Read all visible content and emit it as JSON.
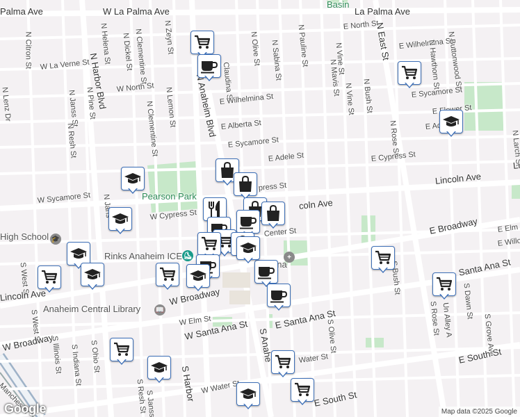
{
  "map": {
    "attribution": "Map data ©2025 Google",
    "logo": "Google"
  },
  "streets": [
    {
      "id": "w-la-palma-ave",
      "text": "W La Palma Ave",
      "cls": "major"
    },
    {
      "id": "la-palma-ave-east",
      "text": "La Palma Ave",
      "cls": "major"
    },
    {
      "id": "la-palma-ave-west",
      "text": "Palma Ave",
      "cls": "major"
    },
    {
      "id": "n-citron-st",
      "text": "N Citron St"
    },
    {
      "id": "n-helena-st",
      "text": "N Helena St"
    },
    {
      "id": "n-dickel-st",
      "text": "N Dickel St"
    },
    {
      "id": "n-clementine-st-top",
      "text": "N Clementine St"
    },
    {
      "id": "n-zeyn-st",
      "text": "N Zeyn St"
    },
    {
      "id": "n-olive-st",
      "text": "N Olive St"
    },
    {
      "id": "n-sabina-st",
      "text": "N Sabina St"
    },
    {
      "id": "n-pauline-st",
      "text": "N Pauline St"
    },
    {
      "id": "e-north-st-top",
      "text": "E North St"
    },
    {
      "id": "n-east-st",
      "text": "N East St",
      "cls": "major"
    },
    {
      "id": "e-wilhelmina-st-right",
      "text": "E Wilhelmina St"
    },
    {
      "id": "n-buttonwood-st",
      "text": "N Buttonwood St"
    },
    {
      "id": "n-hawthorn-st",
      "text": "N Hawthorn St"
    },
    {
      "id": "n-harbor-blvd",
      "text": "N Harbor Blvd",
      "cls": "major"
    },
    {
      "id": "w-la-verne-st",
      "text": "W La Verne St"
    },
    {
      "id": "w-north-st",
      "text": "W North St"
    },
    {
      "id": "n-lemon-st",
      "text": "N Lemon St"
    },
    {
      "id": "n-anaheim-blvd",
      "text": "N Anaheim Blvd",
      "cls": "major"
    },
    {
      "id": "n-claudina-st",
      "text": "Claudina St"
    },
    {
      "id": "e-wilhelmina-st",
      "text": "E Wilhelmina St"
    },
    {
      "id": "n-mavis-st",
      "text": "N Mavis St"
    },
    {
      "id": "n-vine-st-1",
      "text": "N Vine St"
    },
    {
      "id": "n-vine-st-2",
      "text": "N Vine St"
    },
    {
      "id": "n-bush-st",
      "text": "N Bush St"
    },
    {
      "id": "n-lenz-dr",
      "text": "N Lenz Dr"
    },
    {
      "id": "n-janss-st",
      "text": "N Janss St"
    },
    {
      "id": "n-pine-st",
      "text": "N Pine St"
    },
    {
      "id": "n-resh-st",
      "text": "N Resh St"
    },
    {
      "id": "n-clementine-st",
      "text": "N Clementine St"
    },
    {
      "id": "e-alberta-st",
      "text": "E Alberta St"
    },
    {
      "id": "e-sycamore-st-right",
      "text": "E Sycamore St"
    },
    {
      "id": "e-flower-st",
      "text": "E Flower St"
    },
    {
      "id": "e-adele-st-right",
      "text": "E Adele St"
    },
    {
      "id": "n-rose-st",
      "text": "N Rose St"
    },
    {
      "id": "n-larch-st",
      "text": "N Larch St"
    },
    {
      "id": "e-sycamore-st",
      "text": "E Sycamore St"
    },
    {
      "id": "e-adele-st",
      "text": "E Adele St"
    },
    {
      "id": "e-cypress-st",
      "text": "E Cypress St"
    },
    {
      "id": "lincoln-ave-right",
      "text": "Lincoln Ave",
      "cls": "major"
    },
    {
      "id": "lincoln-edge",
      "text": "Li",
      "cls": "major"
    },
    {
      "id": "w-sycamore-st",
      "text": "W Sycamore St"
    },
    {
      "id": "n-janss-st-2",
      "text": "N Jans"
    },
    {
      "id": "w-cypress-st",
      "text": "W Cypress St"
    },
    {
      "id": "cypress-st-mid",
      "text": "press St"
    },
    {
      "id": "lincoln-ave-mid",
      "text": "coln Ave",
      "cls": "major"
    },
    {
      "id": "e-center-st",
      "text": "Center St"
    },
    {
      "id": "e-broadway",
      "text": "E Broadway",
      "cls": "major"
    },
    {
      "id": "e-elm-st",
      "text": "E Elm"
    },
    {
      "id": "e-willow",
      "text": "E Willo"
    },
    {
      "id": "high-school",
      "text": "High School",
      "cls": "poi"
    },
    {
      "id": "s-bush-st",
      "text": "S Bush St"
    },
    {
      "id": "santa-ana-st-right",
      "text": "Santa Ana St",
      "cls": "major"
    },
    {
      "id": "s-dawn-st",
      "text": "S Dawn St"
    },
    {
      "id": "rinks-anaheim-ice",
      "text": "Rinks Anaheim ICE",
      "cls": "poi"
    },
    {
      "id": "s-west-st-1",
      "text": "S West St"
    },
    {
      "id": "s-west-st-2",
      "text": "S West St"
    },
    {
      "id": "lincoln-ave-left",
      "text": "Lincoln Ave",
      "cls": "major"
    },
    {
      "id": "anaheim-central-library",
      "text": "Anaheim Central Library",
      "cls": "poi"
    },
    {
      "id": "w-broadway",
      "text": "W Broadway",
      "cls": "major"
    },
    {
      "id": "w-elm-st",
      "text": "W Elm St"
    },
    {
      "id": "e-santa-ana-st",
      "text": "E Santa Ana St",
      "cls": "major"
    },
    {
      "id": "s-anaheim-blvd",
      "text": "S Anahe",
      "cls": "major"
    },
    {
      "id": "s-olive-st",
      "text": "S Olive St"
    },
    {
      "id": "s-rose-st",
      "text": "S Rose St"
    },
    {
      "id": "un-alley-a",
      "text": "Un Alley A"
    },
    {
      "id": "s-grove-ave",
      "text": "S Grove Ave"
    },
    {
      "id": "w-broadway-left",
      "text": "W Broadway",
      "cls": "major"
    },
    {
      "id": "w-santa-ana-st",
      "text": "W Santa Ana St",
      "cls": "major"
    },
    {
      "id": "s-illinois-st",
      "text": "S Illinois St"
    },
    {
      "id": "s-indiana-st",
      "text": "S Indiana St"
    },
    {
      "id": "s-ohio-st",
      "text": "S Ohio St"
    },
    {
      "id": "water-st",
      "text": "Water St"
    },
    {
      "id": "e-south-st-right",
      "text": "E South St",
      "cls": "major"
    },
    {
      "id": "s-resh-st",
      "text": "S Resh St"
    },
    {
      "id": "s-janss-st",
      "text": "S Janss St"
    },
    {
      "id": "s-harbor-blvd",
      "text": "S Harbor",
      "cls": "major"
    },
    {
      "id": "w-water-st",
      "text": "W Water St"
    },
    {
      "id": "e-south-st",
      "text": "E South St",
      "cls": "major"
    },
    {
      "id": "manchester",
      "text": "Manchester"
    },
    {
      "id": "pearson-park",
      "text": "Pearson Park",
      "cls": "poi green"
    },
    {
      "id": "arena",
      "text": "Arena",
      "cls": "poi"
    },
    {
      "id": "basin",
      "text": "Basin",
      "cls": "poi green"
    }
  ],
  "markers": [
    {
      "id": "m1",
      "type": "shopping-cart",
      "label": "grocery"
    },
    {
      "id": "m2",
      "type": "coffee-cup",
      "label": "cafe"
    },
    {
      "id": "m3",
      "type": "shopping-cart",
      "label": "grocery"
    },
    {
      "id": "m4",
      "type": "graduation-cap",
      "label": "school"
    },
    {
      "id": "m5",
      "type": "shopping-bag",
      "label": "store"
    },
    {
      "id": "m6",
      "type": "shopping-bag",
      "label": "store"
    },
    {
      "id": "m7",
      "type": "graduation-cap",
      "label": "school"
    },
    {
      "id": "m8",
      "type": "graduation-cap",
      "label": "school"
    },
    {
      "id": "m9",
      "type": "fork-knife",
      "label": "restaurant"
    },
    {
      "id": "m10",
      "type": "shopping-bag",
      "label": "store"
    },
    {
      "id": "m11",
      "type": "shopping-bag",
      "label": "store"
    },
    {
      "id": "m12",
      "type": "coffee-cup",
      "label": "cafe"
    },
    {
      "id": "m13",
      "type": "coffee-cup",
      "label": "cafe"
    },
    {
      "id": "m14",
      "type": "shopping-cart",
      "label": "grocery"
    },
    {
      "id": "m15",
      "type": "shopping-bag",
      "label": "store"
    },
    {
      "id": "m16",
      "type": "shopping-cart",
      "label": "grocery"
    },
    {
      "id": "m17",
      "type": "graduation-cap",
      "label": "school"
    },
    {
      "id": "m18",
      "type": "coffee-cup",
      "label": "cafe"
    },
    {
      "id": "m19",
      "type": "shopping-cart",
      "label": "grocery"
    },
    {
      "id": "m20",
      "type": "graduation-cap",
      "label": "school"
    },
    {
      "id": "m21",
      "type": "shopping-cart",
      "label": "grocery"
    },
    {
      "id": "m22",
      "type": "graduation-cap",
      "label": "school"
    },
    {
      "id": "m23",
      "type": "coffee-cup",
      "label": "cafe"
    },
    {
      "id": "m24",
      "type": "coffee-cup",
      "label": "cafe"
    },
    {
      "id": "m25",
      "type": "shopping-cart",
      "label": "grocery"
    },
    {
      "id": "m26",
      "type": "shopping-cart",
      "label": "grocery"
    },
    {
      "id": "m27",
      "type": "graduation-cap",
      "label": "school"
    },
    {
      "id": "m28",
      "type": "shopping-cart",
      "label": "grocery"
    },
    {
      "id": "m29",
      "type": "shopping-cart",
      "label": "grocery"
    },
    {
      "id": "m30",
      "type": "graduation-cap",
      "label": "school"
    },
    {
      "id": "m31",
      "type": "graduation-cap",
      "label": "school"
    },
    {
      "id": "m32",
      "type": "shopping-cart",
      "label": "grocery"
    }
  ],
  "colors": {
    "background": "#f4f1f3",
    "street": "#ffffff",
    "major_street": "#fdfdfd",
    "park": "#c7e8c9",
    "marker_border": "#3d6fb7",
    "icon": "#222222"
  }
}
